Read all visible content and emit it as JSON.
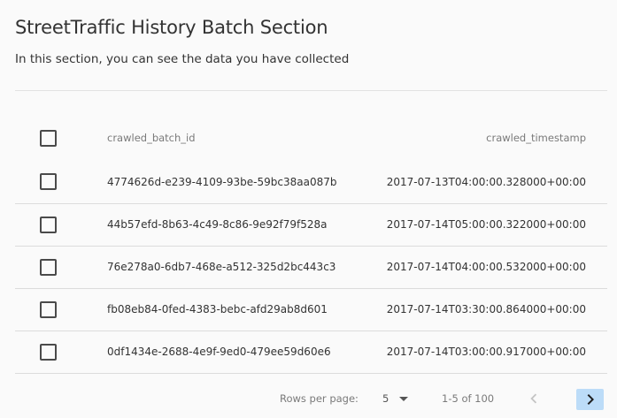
{
  "page": {
    "title": "StreetTraffic History Batch Section",
    "subtitle": "In this section, you can see the data you have collected"
  },
  "table": {
    "columns": [
      "crawled_batch_id",
      "crawled_timestamp"
    ],
    "rows": [
      {
        "crawled_batch_id": "4774626d-e239-4109-93be-59bc38aa087b",
        "crawled_timestamp": "2017-07-13T04:00:00.328000+00:00",
        "checked": false
      },
      {
        "crawled_batch_id": "44b57efd-8b63-4c49-8c86-9e92f79f528a",
        "crawled_timestamp": "2017-07-14T05:00:00.322000+00:00",
        "checked": false
      },
      {
        "crawled_batch_id": "76e278a0-6db7-468e-a512-325d2bc443c3",
        "crawled_timestamp": "2017-07-14T04:00:00.532000+00:00",
        "checked": false
      },
      {
        "crawled_batch_id": "fb08eb84-0fed-4383-bebc-afd29ab8d601",
        "crawled_timestamp": "2017-07-14T03:30:00.864000+00:00",
        "checked": false
      },
      {
        "crawled_batch_id": "0df1434e-2688-4e9f-9ed0-479ee59d60e6",
        "crawled_timestamp": "2017-07-14T03:00:00.917000+00:00",
        "checked": false
      }
    ]
  },
  "pagination": {
    "rows_per_page_label": "Rows per page:",
    "rows_per_page_value": "5",
    "range_label": "1-5 of 100",
    "prev_icon": "chevron-left-icon",
    "next_icon": "chevron-right-icon"
  },
  "colors": {
    "background": "#fafafa",
    "next_button_bg": "#bcdcf8",
    "divider": "#dcdcdc"
  }
}
